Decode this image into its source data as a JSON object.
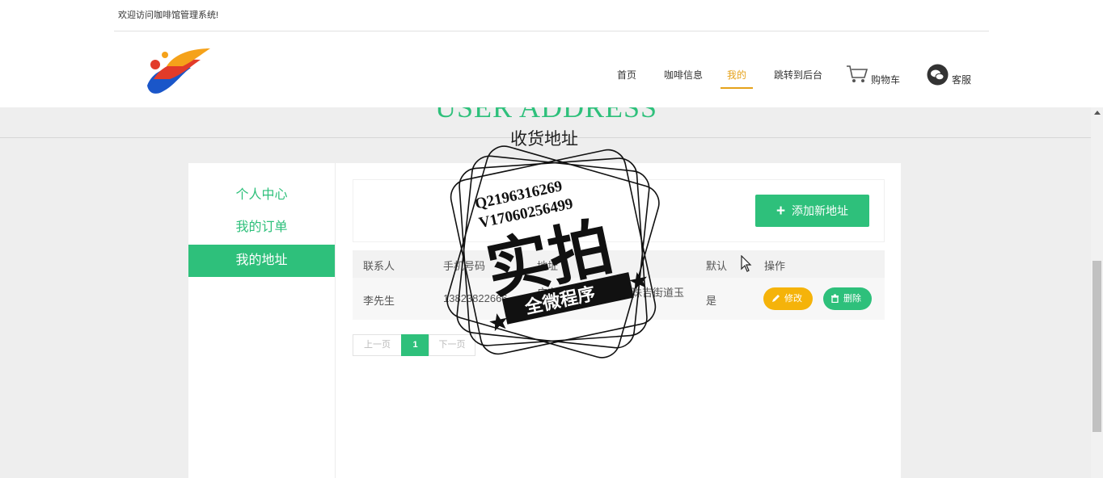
{
  "header": {
    "welcome": "欢迎访问咖啡馆管理系统!",
    "nav": [
      "首页",
      "咖啡信息",
      "我的",
      "跳转到后台"
    ],
    "cart_label": "购物车",
    "service_label": "客服"
  },
  "banner": {
    "title_en": "USER ADDRESS",
    "title_cn": "收货地址"
  },
  "sidebar": {
    "items": [
      "个人中心",
      "我的订单",
      "我的地址"
    ]
  },
  "toolbar": {
    "add_label": "添加新地址"
  },
  "table": {
    "headers": [
      "联系人",
      "手机号码",
      "地址",
      "默认",
      "操作"
    ],
    "rows": [
      {
        "contact": "李先生",
        "phone": "13823822666",
        "address": "广东省广州市天河区珠吉街道玉",
        "default": "是",
        "edit": "修改",
        "delete": "删除"
      }
    ]
  },
  "pagination": {
    "prev": "上一页",
    "current": "1",
    "next": "下一页"
  },
  "stamp": {
    "line1": "Q2196316269",
    "line2": "V17060256499",
    "main": "实拍",
    "ribbon": "全微程序"
  },
  "colors": {
    "accent": "#2ec07b",
    "warning": "#f5b30a",
    "nav_active": "#e5a21a"
  }
}
